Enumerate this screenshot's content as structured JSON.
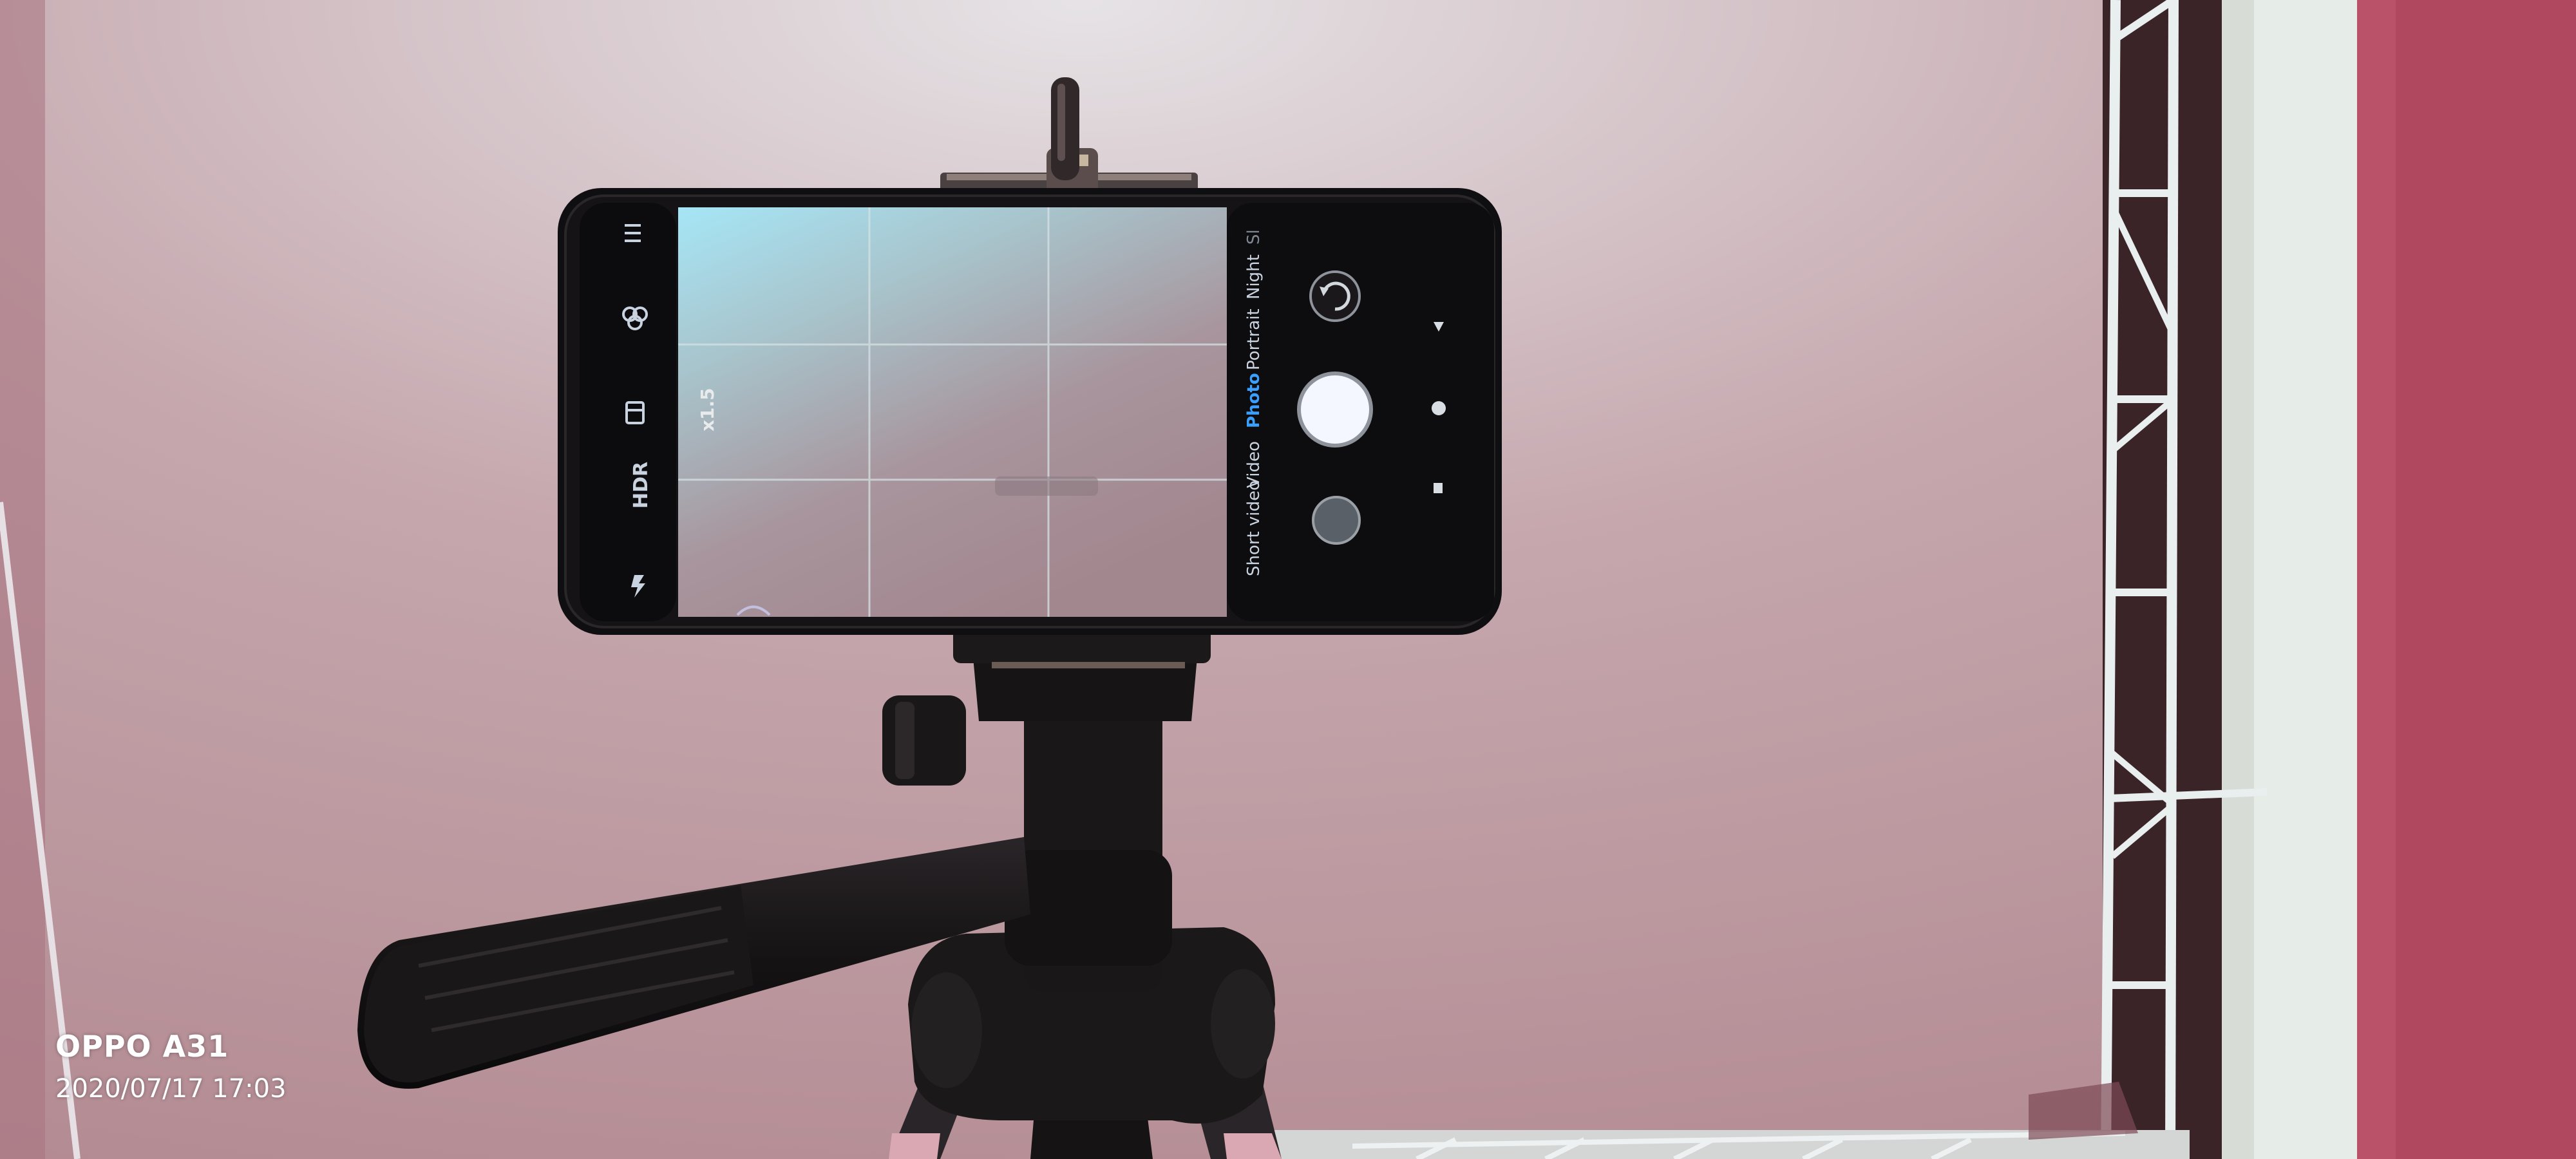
{
  "camera_app": {
    "modes": {
      "short_video": "Short video",
      "video": "Video",
      "photo": "Photo",
      "portrait": "Portrait",
      "night": "Night",
      "partial_next": "Sl"
    },
    "active_mode": "Photo",
    "zoom_level": "x1.5",
    "hdr_label": "HDR",
    "icons": [
      "menu-icon",
      "filters-icon",
      "rectangle-icon",
      "hdr-icon",
      "flash-icon",
      "switch-camera-icon",
      "shutter-button",
      "gallery-thumbnail",
      "nav-back-icon",
      "nav-home-icon",
      "nav-recents-icon"
    ]
  },
  "watermark": {
    "device": "OPPO A31",
    "timestamp": "2020/07/17 17:03"
  },
  "colors": {
    "active_mode": "#3aa0ff",
    "wall": "#c0a0a6",
    "side_wall": "#b0485f"
  }
}
